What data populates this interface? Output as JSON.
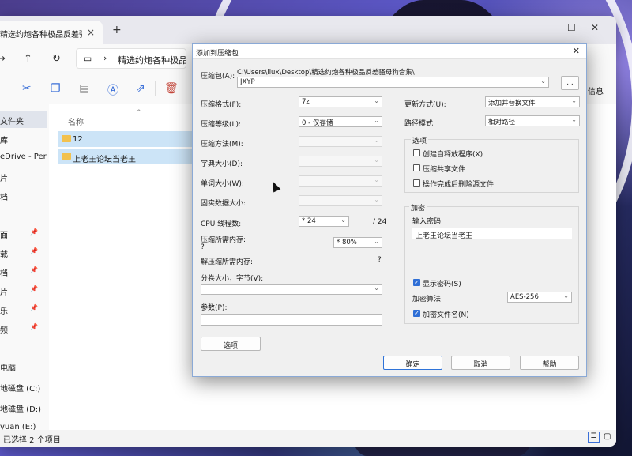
{
  "explorer": {
    "tab_title": "精选约炮各种极品反差骚母狗合",
    "tab_close": "×",
    "new_tab": "+",
    "path": "精选约炮各种极品反差",
    "info_label": "信息",
    "column_name": "名称",
    "sort_glyph": "^",
    "files": [
      "12",
      "上老王论坛当老王"
    ],
    "sidebar": [
      {
        "label": "文件夹",
        "pin": false
      },
      {
        "label": "库",
        "pin": false
      },
      {
        "label": "eDrive - Per",
        "pin": false
      },
      {
        "label": "片",
        "pin": false
      },
      {
        "label": "档",
        "pin": false
      },
      {
        "label": "面",
        "pin": true
      },
      {
        "label": "载",
        "pin": true
      },
      {
        "label": "档",
        "pin": true
      },
      {
        "label": "片",
        "pin": true
      },
      {
        "label": "乐",
        "pin": true
      },
      {
        "label": "频",
        "pin": true
      },
      {
        "label": "电脑",
        "pin": false
      },
      {
        "label": "地磁盘 (C:)",
        "pin": false
      },
      {
        "label": "地磁盘 (D:)",
        "pin": false
      },
      {
        "label": "yuan (E:)",
        "pin": false
      }
    ],
    "status_text": "已选择 2 个项目"
  },
  "dialog": {
    "title": "添加到压缩包",
    "archive_label": "压缩包(A):",
    "archive_dir": "C:\\Users\\liux\\Desktop\\精选约炮各种极品反差骚母狗合集\\",
    "archive_name": "JXYP",
    "browse_label": "...",
    "format_label": "压缩格式(F):",
    "format_value": "7z",
    "level_label": "压缩等级(L):",
    "level_value": "0 - 仅存储",
    "method_label": "压缩方法(M):",
    "dict_label": "字典大小(D):",
    "word_label": "单词大小(W):",
    "solid_label": "固实数据大小:",
    "threads_label": "CPU 线程数:",
    "threads_value": "* 24",
    "threads_max": "/ 24",
    "mem_comp_label": "压缩所需内存:",
    "mem_comp_value": "?",
    "mem_comp_pct": "* 80%",
    "mem_decomp_label": "解压缩所需内存:",
    "mem_decomp_value": "?",
    "volume_label": "分卷大小，字节(V):",
    "params_label": "参数(P):",
    "options_button": "选项",
    "update_label": "更新方式(U):",
    "update_value": "添加并替换文件",
    "path_mode_label": "路径模式",
    "path_mode_value": "相对路径",
    "options_group": "选项",
    "opt_sfx": "创建自释放程序(X)",
    "opt_shared": "压缩共享文件",
    "opt_delete": "操作完成后删除源文件",
    "encrypt_group": "加密",
    "password_label": "输入密码:",
    "password_value": "上老王论坛当老王",
    "show_password": "显示密码(S)",
    "enc_method_label": "加密算法:",
    "enc_method_value": "AES-256",
    "encrypt_names": "加密文件名(N)",
    "ok": "确定",
    "cancel": "取消",
    "help": "帮助"
  }
}
